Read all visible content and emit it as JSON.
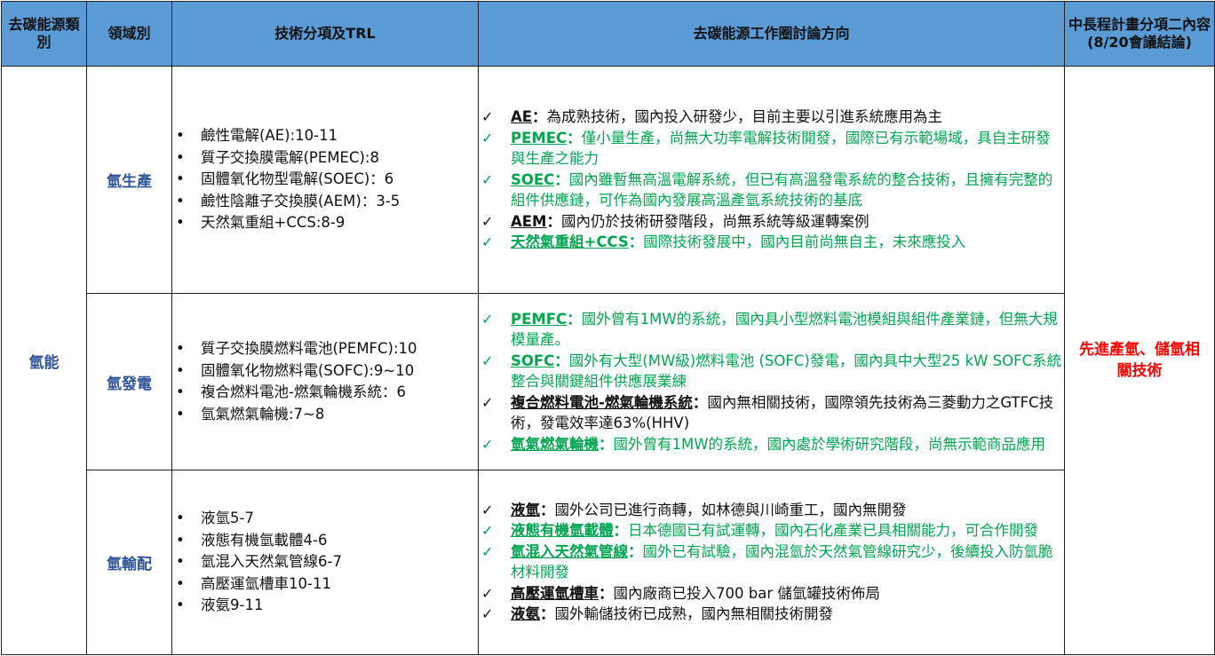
{
  "headers": {
    "col1": "去碳能源類別",
    "col2": "領域別",
    "col3": "技術分項及TRL",
    "col4": "去碳能源工作圈討論方向",
    "col5": "中長程計畫分項二內容(8/20會議結論)"
  },
  "category": "氫能",
  "conclusion": "先進產氫、儲氫相關技術",
  "check_symbol": "✓",
  "colors": {
    "header_bg": "#5b9bd5",
    "domain_text": "#2f5597",
    "green": "#00a550",
    "red": "#ff0000"
  },
  "sections": [
    {
      "domain": "氫生產",
      "techs": [
        "鹼性電解(AE):10-11",
        "質子交換膜電解(PEMEC):8",
        "固體氧化物型電解(SOEC)：6",
        "鹼性陰離子交換膜(AEM)：3-5",
        "天然氣重組+CCS:8-9"
      ],
      "notes": [
        {
          "term": "AE",
          "sep": "：",
          "text": "為成熟技術，國內投入研發少，目前主要以引進系統應用為主",
          "green": false
        },
        {
          "term": "PEMEC",
          "sep": "：",
          "text": "僅小量生產，尚無大功率電解技術開發，國際已有示範場域，具自主研發與生產之能力",
          "green": true
        },
        {
          "term": "SOEC",
          "sep": "：",
          "text": "國內雖暫無高溫電解系統，但已有高溫發電系統的整合技術，且擁有完整的組件供應鏈，可作為國內發展高溫產氫系統技術的基底",
          "green": true
        },
        {
          "term": "AEM",
          "sep": "：",
          "text": "國內仍於技術研發階段，尚無系統等級運轉案例",
          "green": false
        },
        {
          "term": "天然氣重組+CCS",
          "sep": "：",
          "text": "國際技術發展中，國內目前尚無自主，未來應投入",
          "green": true
        }
      ]
    },
    {
      "domain": "氫發電",
      "techs": [
        "質子交換膜燃料電池(PEMFC):10",
        "固體氧化物燃料電(SOFC):9~10",
        "複合燃料電池-燃氣輪機系統：6",
        "氫氣燃氣輪機:7~8"
      ],
      "notes": [
        {
          "term": "PEMFC",
          "sep": "：",
          "text": "國外曾有1MW的系統，國內具小型燃料電池模組與組件產業鏈，但無大規模量產。",
          "green": true
        },
        {
          "term": "SOFC",
          "sep": "：",
          "text": "國外有大型(MW級)燃料電池 (SOFC)發電，國內具中大型25 kW SOFC系統整合與關鍵組件供應展業練",
          "green": true
        },
        {
          "term": "複合燃料電池-燃氣輪機系統",
          "sep": "：",
          "text": "國內無相關技術，國際領先技術為三菱動力之GTFC技術，發電效率達63%(HHV)",
          "green": false
        },
        {
          "term": "氫氣燃氣輪機",
          "sep": "：",
          "text": "國外曾有1MW的系統，國內處於學術研究階段，尚無示範商品應用",
          "green": true
        }
      ]
    },
    {
      "domain": "氫輸配",
      "techs": [
        "液氫5-7",
        "液態有機氫載體4-6",
        "氫混入天然氣管線6-7",
        "高壓運氫槽車10-11",
        "液氨9-11"
      ],
      "notes": [
        {
          "term": "液氫",
          "sep": "：",
          "text": "國外公司已進行商轉，如林德與川崎重工，國內無開發",
          "green": false
        },
        {
          "term": "液態有機氫載體",
          "sep": "：",
          "text": "日本德國已有試運轉，國內石化產業已具相關能力，可合作開發",
          "green": true
        },
        {
          "term": "氫混入天然氣管線",
          "sep": "：",
          "text": "國外已有試驗，國內混氫於天然氣管線研究少，後續投入防氫脆材料開發",
          "green": true
        },
        {
          "term": "高壓運氫槽車",
          "sep": "：",
          "text": "國內廠商已投入700 bar 儲氫罐技術佈局",
          "green": false
        },
        {
          "term": "液氨",
          "sep": "：",
          "text": "國外輸儲技術已成熟，國內無相關技術開發",
          "green": false
        }
      ]
    }
  ]
}
